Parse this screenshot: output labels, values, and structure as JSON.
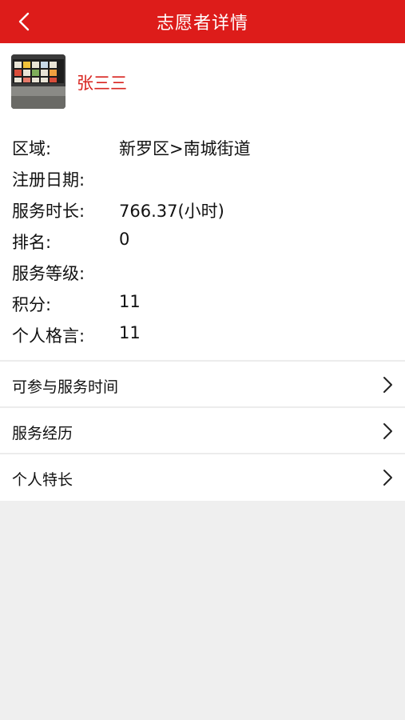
{
  "header": {
    "title": "志愿者详情",
    "back_icon": "chevron-left-icon"
  },
  "profile": {
    "name": "张三三",
    "avatar_icon": "volunteer-avatar-photo"
  },
  "details": [
    {
      "label": "区域:",
      "value": "新罗区>南城街道"
    },
    {
      "label": "注册日期:",
      "value": ""
    },
    {
      "label": "服务时长:",
      "value": "766.37(小时)"
    },
    {
      "label": "排名:",
      "value": "0"
    },
    {
      "label": "服务等级:",
      "value": ""
    },
    {
      "label": "积分:",
      "value": "11"
    },
    {
      "label": "个人格言:",
      "value": "11"
    }
  ],
  "menu": [
    {
      "label": "可参与服务时间",
      "icon": "chevron-right-icon"
    },
    {
      "label": "服务经历",
      "icon": "chevron-right-icon"
    },
    {
      "label": "个人特长",
      "icon": "chevron-right-icon"
    }
  ],
  "colors": {
    "header_bg": "#dd1c1a",
    "name_color": "#d8241f",
    "page_bg": "#efefef"
  }
}
